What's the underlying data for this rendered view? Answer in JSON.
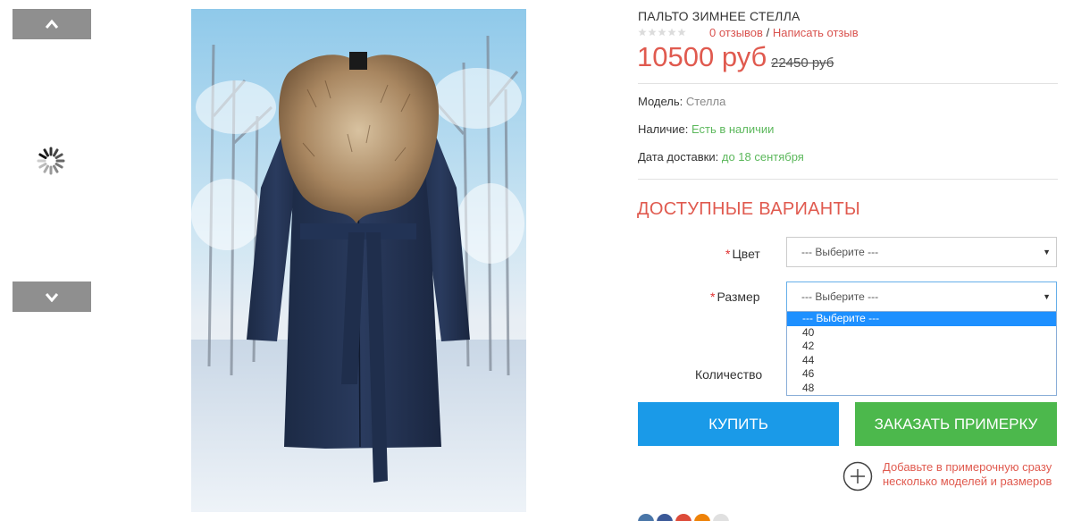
{
  "thumbnails": {
    "up_icon": "chevron-up-icon",
    "down_icon": "chevron-down-icon",
    "loading_icon": "spinner-icon"
  },
  "product": {
    "title": "ПАЛЬТО ЗИМНЕЕ СТЕЛЛА",
    "rating": 0,
    "reviews_link": "0 отзывов",
    "review_separator": "/",
    "write_review_link": "Написать отзыв",
    "price": "10500 руб",
    "old_price": "22450 руб"
  },
  "details": {
    "model_label": "Модель:",
    "model_value": "Стелла",
    "stock_label": "Наличие:",
    "stock_value": "Есть в наличии",
    "delivery_label": "Дата доставки:",
    "delivery_value": "до 18 сентября"
  },
  "options": {
    "heading": "ДОСТУПНЫЕ ВАРИАНТЫ",
    "required_mark": "*",
    "color_label": "Цвет",
    "color_value": "--- Выберите ---",
    "size_label": "Размер",
    "size_value": "--- Выберите ---",
    "size_options": [
      "--- Выберите ---",
      "40",
      "42",
      "44",
      "46",
      "48"
    ],
    "quantity_label": "Количество"
  },
  "actions": {
    "buy_label": "КУПИТЬ",
    "try_on_label": "ЗАКАЗАТЬ ПРИМЕРКУ",
    "add_note": "Добавьте в примерочную сразу несколько моделей и размеров"
  },
  "colors": {
    "accent_red": "#e05a4f",
    "buy_blue": "#1a9ae8",
    "try_green": "#4cb84c",
    "in_stock_green": "#5cb85c",
    "thumb_nav_gray": "#8f8f8f"
  },
  "share": [
    "vk-icon",
    "facebook-icon",
    "google-plus-icon",
    "odnoklassniki-icon",
    "more-icon"
  ]
}
